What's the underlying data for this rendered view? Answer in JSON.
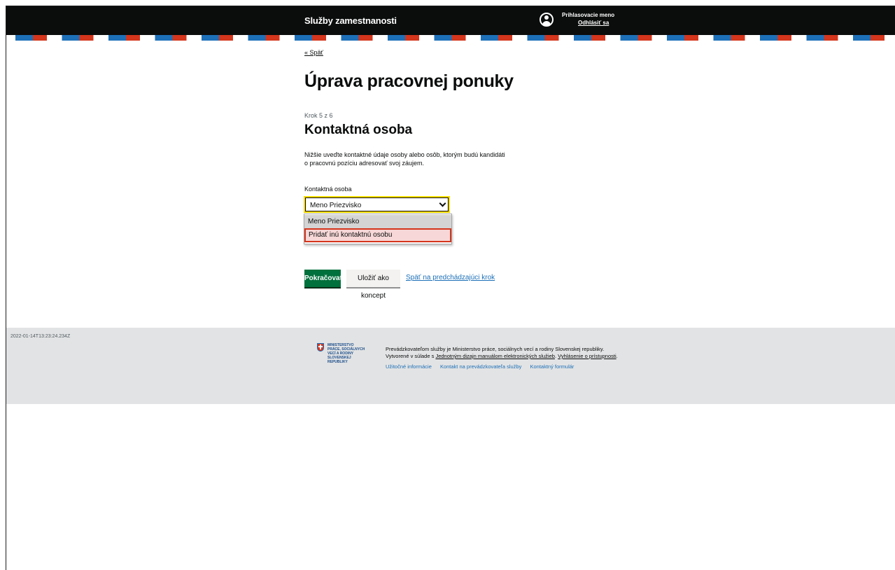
{
  "header": {
    "service_name": "Služby zamestnanosti",
    "user_name": "Prihlasovacie meno",
    "logout_label": "Odhlásiť sa"
  },
  "main": {
    "back_label": "« Späť",
    "page_title": "Úprava pracovnej ponuky",
    "step_label": "Krok 5 z 6",
    "section_title": "Kontaktná osoba",
    "description": "Nižšie uveďte kontaktné údaje osoby alebo osôb, ktorým budú kandidáti o pracovnú pozíciu adresovať svoj záujem.",
    "contact_field": {
      "label": "Kontaktná osoba",
      "selected_value": "Meno Priezvisko",
      "options": [
        "Meno Priezvisko",
        "Pridať inú kontaktnú osobu"
      ]
    },
    "buttons": {
      "continue": "Pokračovať",
      "save_draft": "Uložiť ako koncept",
      "previous_step": "Späť na predchádzajúci krok"
    }
  },
  "footer": {
    "timestamp": "2022-01-14T13:23:24.234Z",
    "logo_text": "MINISTERSTVO\nPRÁCE, SOCIÁLNYCH\nVECÍ A RODINY\nSLOVENSKEJ REPUBLIKY",
    "text_part1": "Prevádzkovateľom služby je Ministerstvo práce, sociálnych vecí a rodiny Slovenskej republiky. Vytvorené v súlade s ",
    "text_link1": "Jednotným dizajn manuálom elektronických služieb",
    "text_part2": ". ",
    "text_link2": "Vyhlásenie o prístupnosti",
    "text_part3": ".",
    "links": [
      "Užitočné informácie",
      "Kontakt na prevádzkovateľa služby",
      "Kontaktný formulár"
    ]
  },
  "colors": {
    "header_bg": "#0b0c0c",
    "primary_button": "#00703c",
    "focus": "#ffdd00",
    "highlight_border": "#d4351c",
    "link": "#1d70b8",
    "footer_bg": "#e2e3e4"
  }
}
